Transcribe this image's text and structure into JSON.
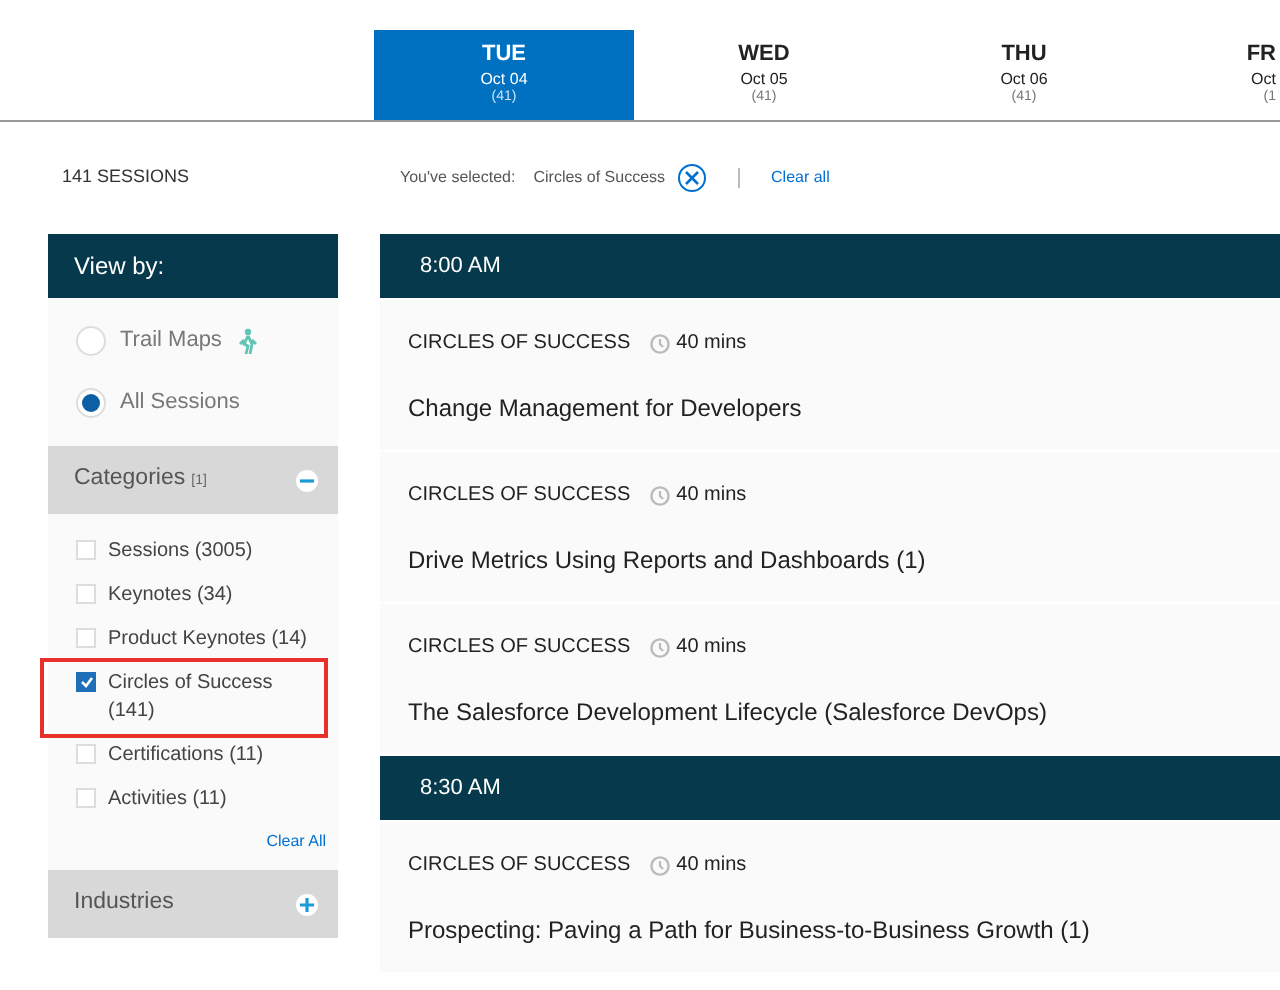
{
  "days": [
    {
      "day": "TUE",
      "date": "Oct 04",
      "count": "(41)",
      "selected": true
    },
    {
      "day": "WED",
      "date": "Oct 05",
      "count": "(41)",
      "selected": false
    },
    {
      "day": "THU",
      "date": "Oct 06",
      "count": "(41)",
      "selected": false
    },
    {
      "day": "FR",
      "date": "Oct",
      "count": "(1",
      "selected": false
    }
  ],
  "session_count": "141 SESSIONS",
  "filter_bar": {
    "label": "You've selected:",
    "chip": "Circles of Success",
    "clear": "Clear all"
  },
  "sidebar": {
    "title": "View by:",
    "view_options": [
      {
        "label": "Trail Maps",
        "selected": false,
        "kind": "trail"
      },
      {
        "label": "All Sessions",
        "selected": true,
        "kind": "plain"
      }
    ],
    "sections": [
      {
        "title": "Categories",
        "count": "[1]",
        "expanded": true,
        "items": [
          {
            "label": "Sessions (3005)",
            "checked": false,
            "highlighted": false
          },
          {
            "label": "Keynotes (34)",
            "checked": false,
            "highlighted": false
          },
          {
            "label": "Product Keynotes (14)",
            "checked": false,
            "highlighted": false
          },
          {
            "label": "Circles of Success (141)",
            "checked": true,
            "highlighted": true
          },
          {
            "label": "Certifications (11)",
            "checked": false,
            "highlighted": false
          },
          {
            "label": "Activities (11)",
            "checked": false,
            "highlighted": false
          }
        ],
        "clear": "Clear All"
      },
      {
        "title": "Industries",
        "expanded": false
      }
    ]
  },
  "timeslots": [
    {
      "time": "8:00 AM",
      "sessions": [
        {
          "category": "CIRCLES OF SUCCESS",
          "duration": "40 mins",
          "title": "Change Management for Developers"
        },
        {
          "category": "CIRCLES OF SUCCESS",
          "duration": "40 mins",
          "title": "Drive Metrics Using Reports and Dashboards (1)"
        },
        {
          "category": "CIRCLES OF SUCCESS",
          "duration": "40 mins",
          "title": "The Salesforce Development Lifecycle (Salesforce DevOps)"
        }
      ]
    },
    {
      "time": "8:30 AM",
      "sessions": [
        {
          "category": "CIRCLES OF SUCCESS",
          "duration": "40 mins",
          "title": "Prospecting: Paving a Path for Business-to-Business Growth (1)"
        }
      ]
    }
  ]
}
